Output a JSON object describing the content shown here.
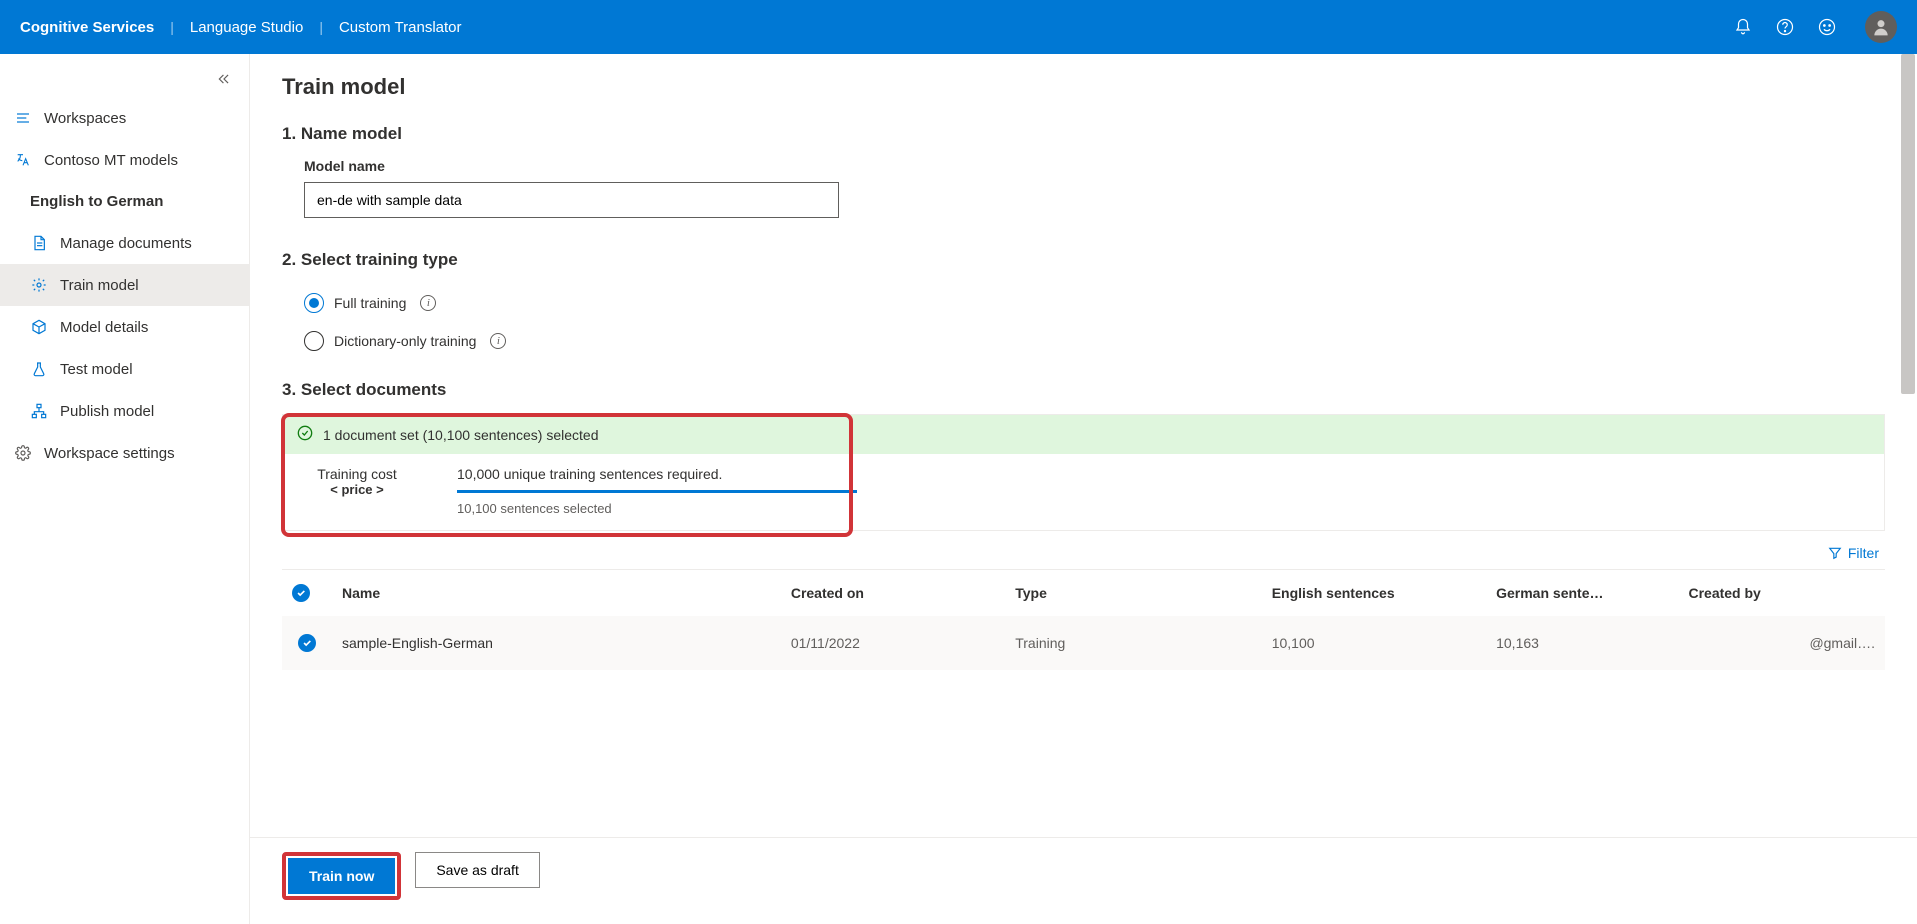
{
  "header": {
    "brand": "Cognitive Services",
    "crumb1": "Language Studio",
    "crumb2": "Custom Translator"
  },
  "sidebar": {
    "workspaces": "Workspaces",
    "models": "Contoso MT models",
    "project": "English to German",
    "items": {
      "manage_documents": "Manage documents",
      "train_model": "Train model",
      "model_details": "Model details",
      "test_model": "Test model",
      "publish_model": "Publish model"
    },
    "workspace_settings": "Workspace settings"
  },
  "page": {
    "title": "Train model",
    "step1": "1. Name model",
    "model_name_label": "Model name",
    "model_name_value": "en-de with sample data",
    "step2": "2. Select training type",
    "radio_full": "Full training",
    "radio_dict": "Dictionary-only training",
    "step3": "3. Select documents",
    "sel_summary": "1 document set (10,100 sentences) selected",
    "cost_label": "Training cost",
    "cost_price": "< price >",
    "req_label": "10,000 unique training sentences required.",
    "sel_count": "10,100 sentences selected",
    "filter_label": "Filter"
  },
  "table": {
    "cols": {
      "name": "Name",
      "created_on": "Created on",
      "type": "Type",
      "en_sent": "English sentences",
      "de_sent": "German sente…",
      "created_by": "Created by"
    },
    "row": {
      "name": "sample-English-German",
      "created_on": "01/11/2022",
      "type": "Training",
      "en_sent": "10,100",
      "de_sent": "10,163",
      "created_by": "@gmail…."
    }
  },
  "footer": {
    "train_now": "Train now",
    "save_draft": "Save as draft"
  }
}
